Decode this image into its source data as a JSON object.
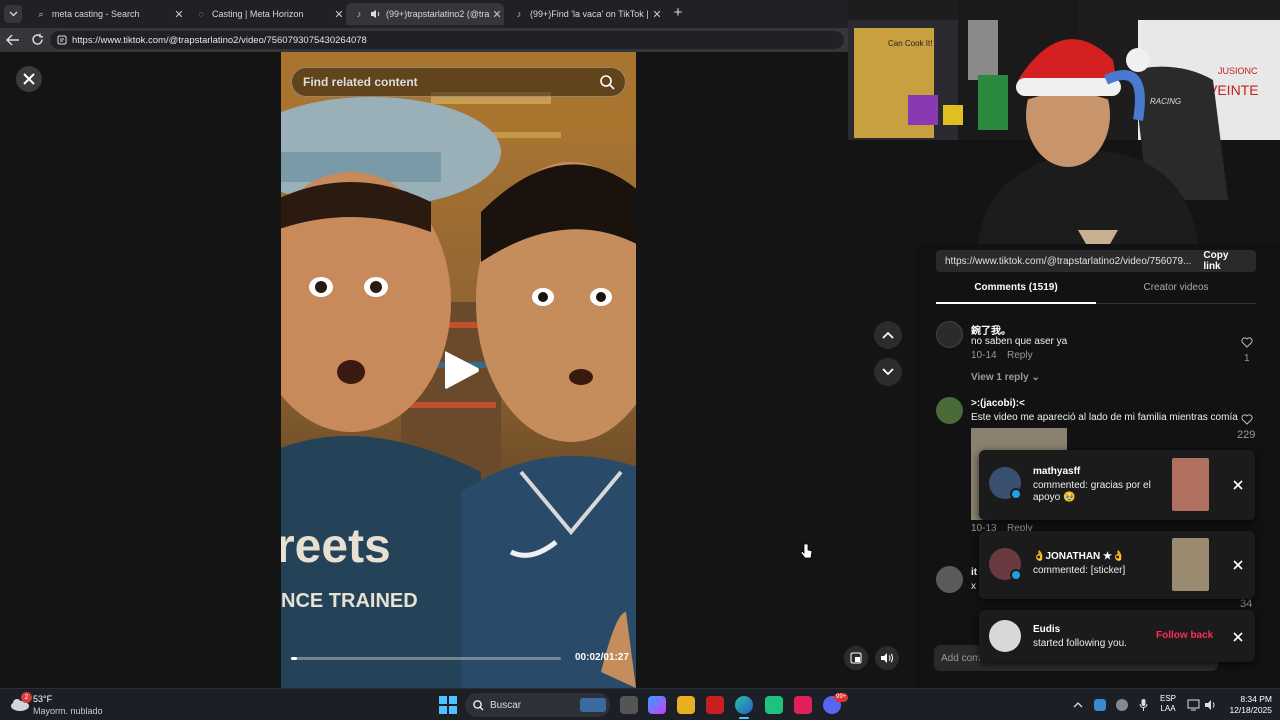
{
  "browser": {
    "tabs": [
      {
        "title": "meta casting - Search",
        "favicon": "search-icon"
      },
      {
        "title": "Casting | Meta Horizon",
        "favicon": "loading-icon"
      },
      {
        "title": "(99+)trapstarlatino2 (@trapst",
        "favicon": "tiktok-icon",
        "active": true
      },
      {
        "title": "(99+)Find 'la vaca' on TikTok | TikTo",
        "favicon": "tiktok-icon"
      }
    ],
    "url": "https://www.tiktok.com/@trapstarlatino2/video/7560793075430264078"
  },
  "video": {
    "search_placeholder": "Find related content",
    "time": "00:02/01:27",
    "progress": 0.023,
    "shirt_text_1": "reets",
    "shirt_text_2": "NCE TRAINED"
  },
  "panel": {
    "share_url": "https://www.tiktok.com/@trapstarlatino2/video/756079...",
    "copy_link": "Copy link",
    "tabs": {
      "comments": "Comments (1519)",
      "creator_videos": "Creator videos"
    },
    "comments": [
      {
        "user": "鋺了我。",
        "text": "no saben que aser ya",
        "date": "10-14",
        "reply": "Reply",
        "likes": "1",
        "view_replies": "View 1 reply"
      },
      {
        "user": ">:(jacobi):<",
        "text": "Este video me apareció al lado de mi familia mientras comía",
        "date": "10-13",
        "reply": "Reply",
        "likes": "229"
      },
      {
        "user": "it",
        "text": "x",
        "likes": "34"
      }
    ],
    "add_comment": "Add com"
  },
  "notifications": [
    {
      "name": "mathyasff",
      "message": "commented: gracias por el apoyo 🥹"
    },
    {
      "name": "👌JONATHAN ★👌",
      "message": "commented: [sticker]"
    },
    {
      "name": "Eudis",
      "message": "started following you.",
      "action": "Follow back"
    }
  ],
  "taskbar": {
    "weather_temp": "53°F",
    "weather_desc": "Mayorm. nublado",
    "search_label": "Buscar",
    "lang_1": "ESP",
    "lang_2": "LAA",
    "time": "8:34 PM",
    "date": "12/18/2025",
    "weather_badge": "2",
    "discord_badge": "99+"
  },
  "webcam": {
    "poster_text": "Can Cook It!",
    "whiteboard_text_1": "VEINTE",
    "whiteboard_text_2": "JUSIONC",
    "chair_text": "RACING"
  },
  "colors": {
    "accent": "#fe2c55",
    "bg": "#121212",
    "taskbar": "#1c1f26"
  }
}
